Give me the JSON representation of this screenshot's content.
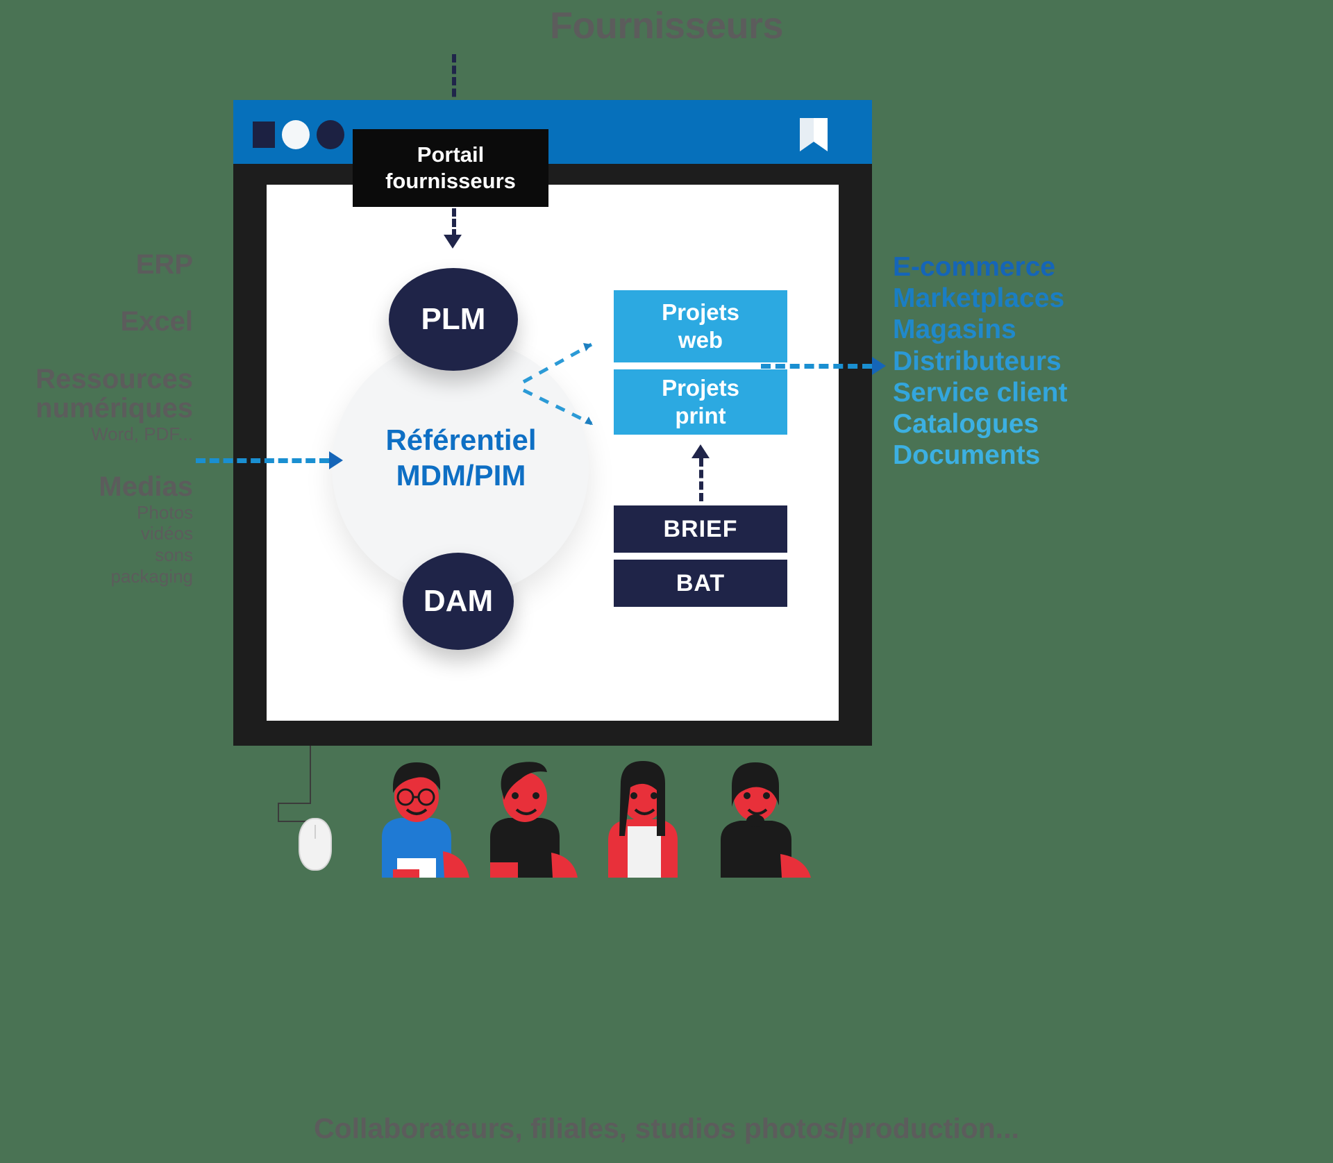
{
  "diagram": {
    "top_title": "Fournisseurs",
    "bottom_caption": "Collaborateurs, filiales, studios photos/production...",
    "portal_box": {
      "line1": "Portail",
      "line2": "fournisseurs"
    },
    "center": {
      "plm_label": "PLM",
      "dam_label": "DAM",
      "repository_line1": "Référentiel",
      "repository_line2": "MDM/PIM"
    },
    "projects": [
      {
        "line1": "Projets",
        "line2": "web"
      },
      {
        "line1": "Projets",
        "line2": "print"
      }
    ],
    "docs": [
      {
        "label": "BRIEF"
      },
      {
        "label": "BAT"
      }
    ],
    "inputs": [
      {
        "title": "ERP",
        "sub": ""
      },
      {
        "title": "Excel",
        "sub": ""
      },
      {
        "title": "Ressources numériques",
        "sub": "Word, PDF..."
      },
      {
        "title": "Medias",
        "sub": "Photos\nvidéos\nsons\npackaging"
      }
    ],
    "outputs": [
      {
        "label": "E-commerce",
        "color": "#1565b8"
      },
      {
        "label": "Marketplaces",
        "color": "#1a7ec4"
      },
      {
        "label": "Magasins",
        "color": "#2089cb"
      },
      {
        "label": "Distributeurs",
        "color": "#2b99d6"
      },
      {
        "label": "Service client",
        "color": "#33a6dd"
      },
      {
        "label": "Catalogues",
        "color": "#3cb0e2"
      },
      {
        "label": "Documents",
        "color": "#3cb0e2"
      }
    ],
    "icons": {
      "window_square": "window-square-icon",
      "window_circle_light": "window-circle-light-icon",
      "window_circle_dark": "window-circle-dark-icon",
      "bookmark": "bookmark-icon",
      "mouse": "mouse-icon"
    },
    "colors": {
      "titlebar": "#0670bb",
      "window_frame": "#1d1d1d",
      "accent_light_blue": "#2ca9e1",
      "accent_dark_navy": "#1f2448",
      "repo_blue": "#0e6fc4",
      "grey_text": "#5c5c5c",
      "background": "#4a7354"
    }
  }
}
